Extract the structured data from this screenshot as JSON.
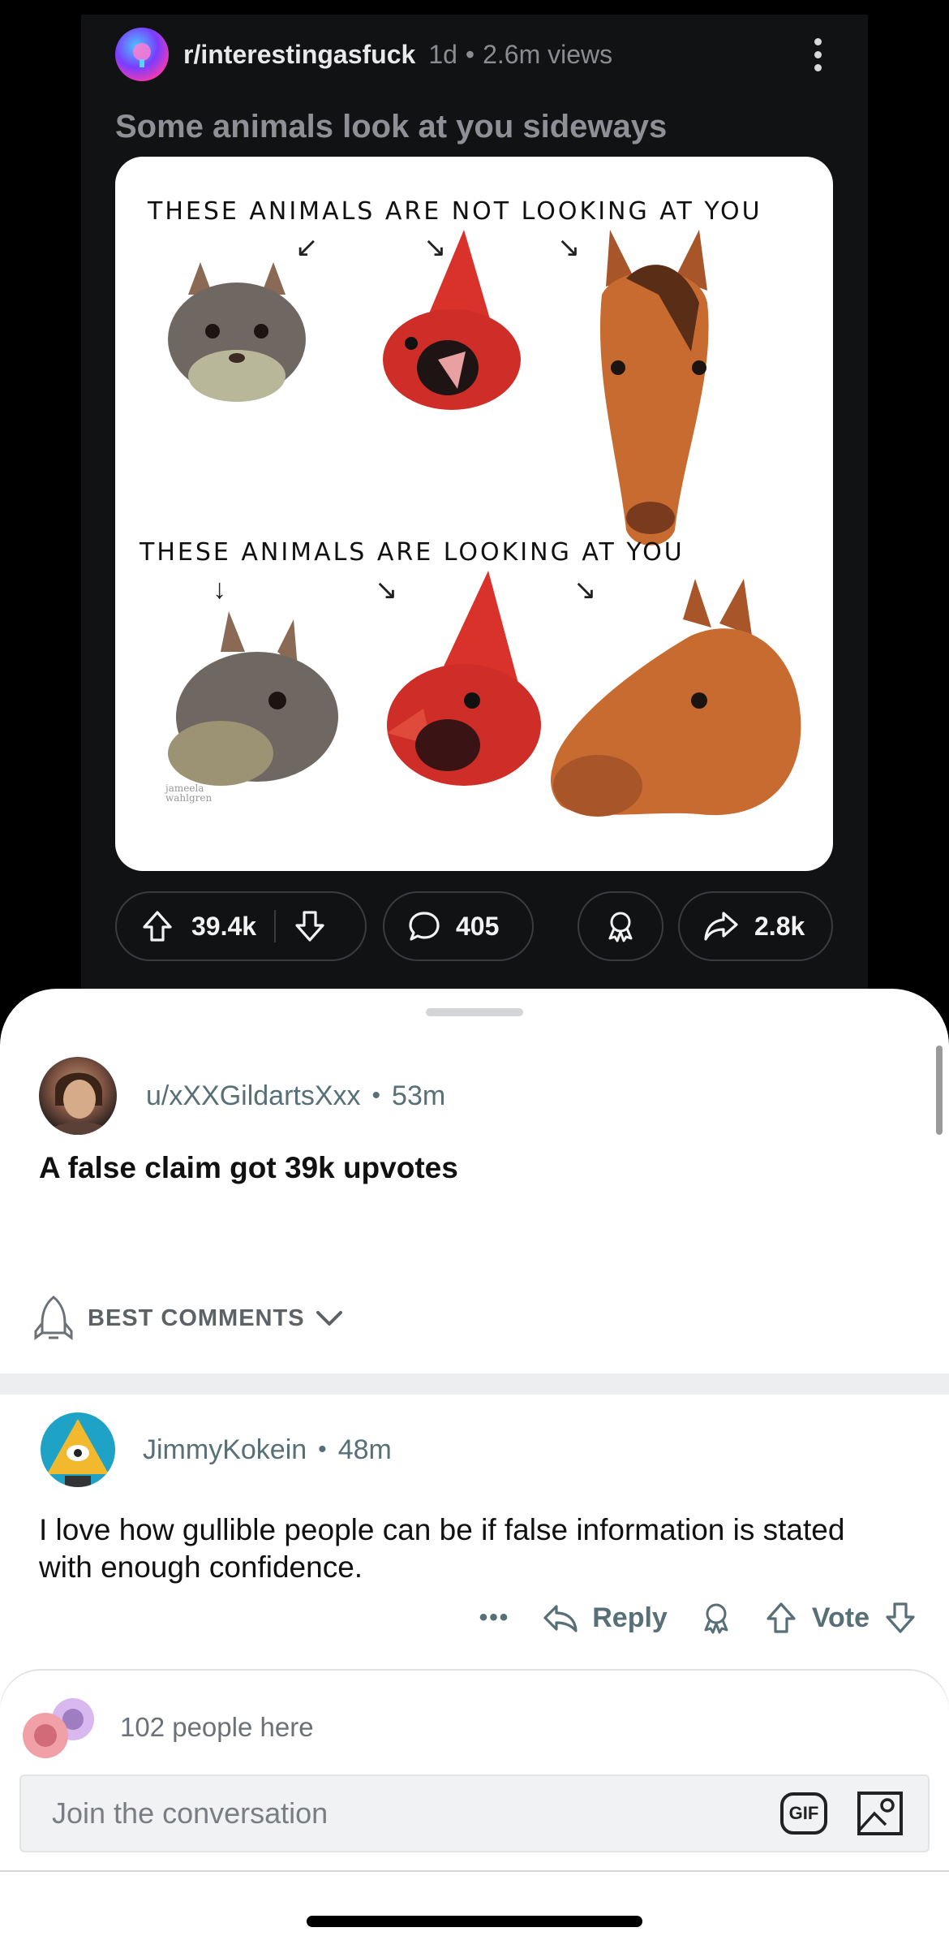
{
  "post": {
    "subreddit": "r/interestingasfuck",
    "age": "1d",
    "separator": "•",
    "views": "2.6m views",
    "title": "Some animals look at you sideways",
    "image": {
      "caption_top": "THESE ANIMALS ARE NOT LOOKING AT YOU",
      "caption_bottom": "THESE ANIMALS ARE LOOKING AT YOU",
      "signature": "jameela wahlgren"
    },
    "upvotes": "39.4k",
    "comments": "405",
    "shares": "2.8k"
  },
  "op_comment": {
    "username": "u/xXXGildartsXxx",
    "separator": "•",
    "time": "53m",
    "body": "A false claim got 39k upvotes"
  },
  "sort": {
    "label": "BEST COMMENTS"
  },
  "comment": {
    "username": "JimmyKokein",
    "separator": "•",
    "time": "48m",
    "body": "I love how gullible people can be if false information is stated with enough confidence.",
    "more": "•••",
    "reply_label": "Reply",
    "vote_label": "Vote"
  },
  "composer": {
    "presence": "102 people here",
    "placeholder": "Join the conversation",
    "gif_label": "GIF"
  },
  "colors": {
    "meta_gray": "#576f76",
    "dark_bg": "#111214",
    "sheet_bg": "#ffffff"
  }
}
